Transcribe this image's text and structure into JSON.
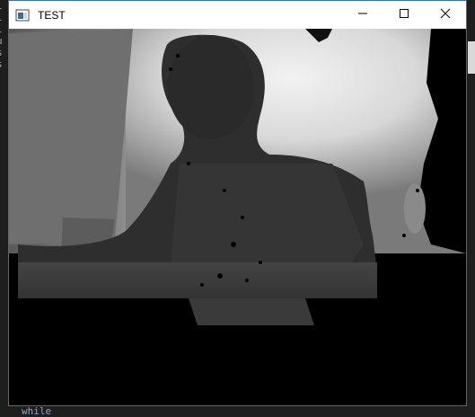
{
  "window": {
    "title": "TEST",
    "app_icon": "window-app-icon",
    "controls": {
      "minimize": "minimize-icon",
      "maximize": "maximize-icon",
      "close": "close-icon"
    }
  },
  "content": {
    "type": "depth-camera-image",
    "description_icon": "depth-image"
  },
  "background": {
    "status_word": "while"
  },
  "colors": {
    "window_border": "#3a6ea5",
    "titlebar": "#ffffff",
    "client_bg": "#000000"
  }
}
